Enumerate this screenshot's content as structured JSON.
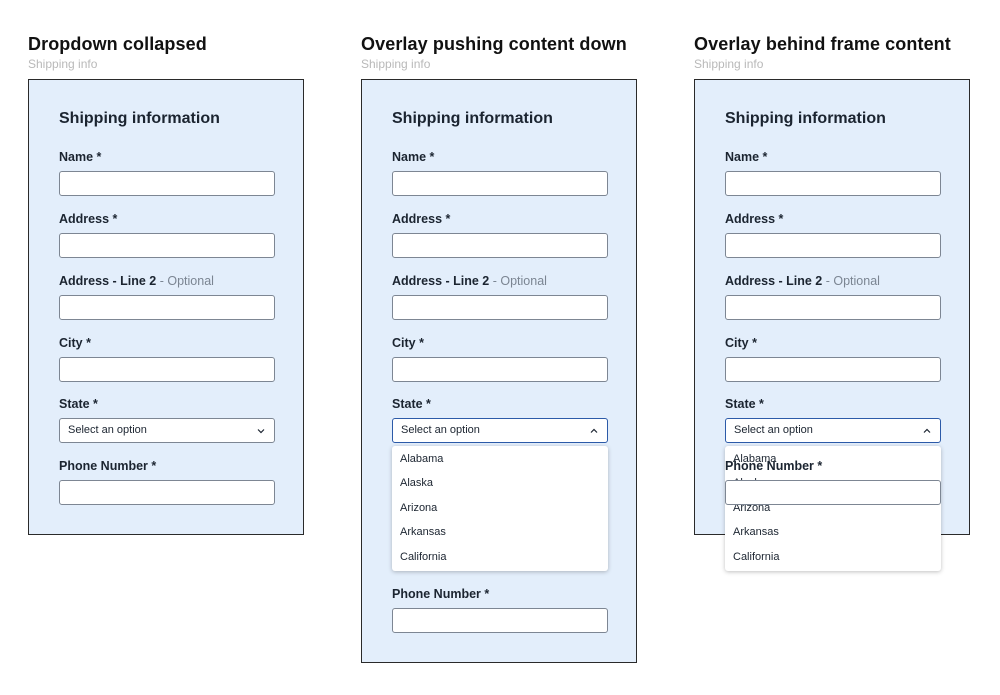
{
  "panels": [
    {
      "title": "Dropdown collapsed",
      "subtitle": "Shipping info",
      "form_title": "Shipping information",
      "name_label": "Name *",
      "address_label": "Address *",
      "address2_label": "Address - Line 2",
      "address2_optional": "- Optional",
      "city_label": "City *",
      "state_label": "State *",
      "state_value": "Select an option",
      "phone_label": "Phone Number *",
      "dropdown_state": "collapsed"
    },
    {
      "title": "Overlay pushing content down",
      "subtitle": "Shipping info",
      "form_title": "Shipping information",
      "name_label": "Name *",
      "address_label": "Address *",
      "address2_label": "Address - Line 2",
      "address2_optional": "- Optional",
      "city_label": "City *",
      "state_label": "State *",
      "state_value": "Select an option",
      "phone_label": "Phone Number *",
      "dropdown_state": "expanded",
      "options": [
        "Alabama",
        "Alaska",
        "Arizona",
        "Arkansas",
        "California"
      ]
    },
    {
      "title": "Overlay behind frame content",
      "subtitle": "Shipping info",
      "form_title": "Shipping information",
      "name_label": "Name *",
      "address_label": "Address *",
      "address2_label": "Address - Line 2",
      "address2_optional": "- Optional",
      "city_label": "City *",
      "state_label": "State *",
      "state_value": "Select an option",
      "phone_label": "Phone Number *",
      "dropdown_state": "expanded",
      "options": [
        "Alabama",
        "Alaska",
        "Arizona",
        "Arkansas",
        "California"
      ]
    }
  ],
  "icons": {
    "collapsed_chevron": "chevron-down-icon",
    "expanded_chevron": "chevron-up-icon"
  },
  "colors": {
    "frame_bg": "#e3eefb",
    "focus_border": "#2c5aa8",
    "optional_text": "#7b8592"
  }
}
